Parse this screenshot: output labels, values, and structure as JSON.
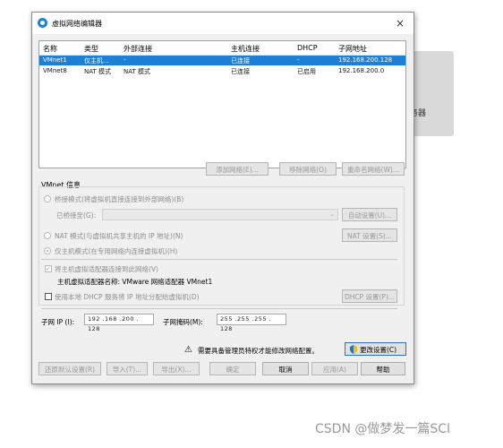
{
  "background": {
    "partial_text": "务器",
    "arrow": "▸"
  },
  "window": {
    "title": "虚拟网络编辑器",
    "close_glyph": "×"
  },
  "table": {
    "headers": [
      "名称",
      "类型",
      "外部连接",
      "主机连接",
      "DHCP",
      "子网地址"
    ],
    "rows": [
      {
        "cells": [
          "VMnet1",
          "仅主机...",
          "-",
          "已连接",
          "-",
          "192.168.200.128"
        ],
        "selected": true
      },
      {
        "cells": [
          "VMnet8",
          "NAT 模式",
          "NAT 模式",
          "已连接",
          "已启用",
          "192.168.200.0"
        ],
        "selected": false
      }
    ]
  },
  "table_buttons": {
    "add": "添加网络(E)...",
    "remove": "移除网络(O)",
    "rename": "重命名网络(W)..."
  },
  "vmnet_info": {
    "label": "VMnet 信息",
    "bridged": "桥接模式(将虚拟机直接连接到外部网络)(B)",
    "bridged_to_label": "已桥接至(G):",
    "bridged_to_value": "",
    "auto_settings": "自动设置(U)...",
    "nat": "NAT 模式(与虚拟机共享主机的 IP 地址)(N)",
    "nat_settings": "NAT 设置(S)...",
    "host_only": "仅主机模式(在专用网络内连接虚拟机)(H)",
    "connect_adapter": "将主机虚拟适配器连接到此网络(V)",
    "adapter_name": "主机虚拟适配器名称: VMware 网络适配器 VMnet1",
    "use_dhcp": "使用本地 DHCP 服务将 IP 地址分配给虚拟机(D)",
    "dhcp_settings": "DHCP 设置(P)...",
    "subnet_ip_label": "子网 IP (I):",
    "subnet_ip": "192 .168 .200 . 128",
    "subnet_mask_label": "子网掩码(M):",
    "subnet_mask": "255 .255 .255 . 128"
  },
  "admin": {
    "warning_glyph": "⚠",
    "notice": "需要具备管理员特权才能修改网络配置。",
    "change_settings": "更改设置(C)"
  },
  "footer": {
    "restore": "还原默认设置(R)",
    "import": "导入(T)...",
    "export": "导出(X)...",
    "ok": "确定",
    "cancel": "取消",
    "apply": "应用(A)",
    "help": "帮助"
  },
  "watermark": "CSDN @做梦发一篇SCI",
  "colors": {
    "selection": "#1e7fd6",
    "dialog_bg": "#f0f0f0",
    "accent": "#2a72c7"
  }
}
